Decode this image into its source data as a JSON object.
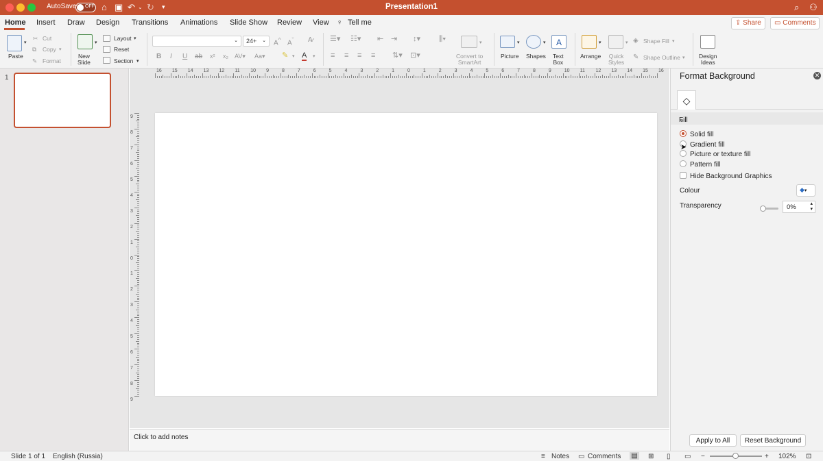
{
  "titlebar": {
    "autosave": "AutoSave",
    "toggle": "OFF",
    "title": "Presentation1"
  },
  "tabs": [
    "Home",
    "Insert",
    "Draw",
    "Design",
    "Transitions",
    "Animations",
    "Slide Show",
    "Review",
    "View",
    "Tell me"
  ],
  "share": "Share",
  "comments": "Comments",
  "ribbon": {
    "paste": "Paste",
    "cut": "Cut",
    "copy": "Copy",
    "format": "Format",
    "new_slide": "New\nSlide",
    "layout": "Layout",
    "reset": "Reset",
    "section": "Section",
    "font_size": "24+",
    "convert": "Convert to\nSmartArt",
    "picture": "Picture",
    "shapes": "Shapes",
    "text_box": "Text\nBox",
    "arrange": "Arrange",
    "quick_styles": "Quick\nStyles",
    "shape_fill": "Shape Fill",
    "shape_outline": "Shape Outline",
    "design_ideas": "Design\nIdeas"
  },
  "thumbs": {
    "number": "1"
  },
  "ruler_h": [
    "16",
    "15",
    "14",
    "13",
    "12",
    "11",
    "10",
    "9",
    "8",
    "7",
    "6",
    "5",
    "4",
    "3",
    "2",
    "1",
    "0",
    "1",
    "2",
    "3",
    "4",
    "5",
    "6",
    "7",
    "8",
    "9",
    "10",
    "11",
    "12",
    "13",
    "14",
    "15",
    "16"
  ],
  "ruler_v": [
    "9",
    "8",
    "7",
    "6",
    "5",
    "4",
    "3",
    "2",
    "1",
    "0",
    "1",
    "2",
    "3",
    "4",
    "5",
    "6",
    "7",
    "8",
    "9"
  ],
  "notes": "Click to add notes",
  "pane": {
    "title": "Format Background",
    "section": "Fill",
    "options": [
      "Solid fill",
      "Gradient fill",
      "Picture or texture fill",
      "Pattern fill"
    ],
    "selected": "Solid fill",
    "hide_graphics": "Hide Background Graphics",
    "colour": "Colour",
    "transparency": "Transparency",
    "transparency_value": "0%",
    "transparency_level": 0,
    "apply_all": "Apply to All",
    "reset_bg": "Reset Background",
    "accent": "#c4502f"
  },
  "status": {
    "slide": "Slide 1 of 1",
    "language": "English (Russia)",
    "notes": "Notes",
    "comments": "Comments",
    "zoom": "102%"
  }
}
